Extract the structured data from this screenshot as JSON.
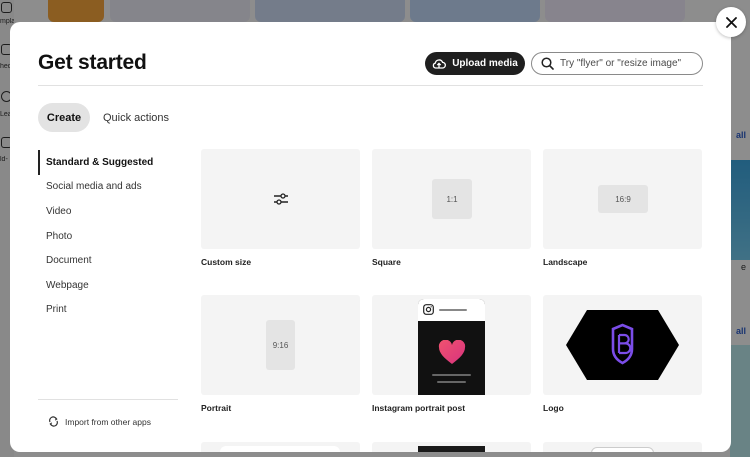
{
  "background": {
    "sidebar_labels": [
      "mpla",
      "hed",
      "Lea",
      "ld-"
    ],
    "right_links": [
      "all",
      "all"
    ],
    "right_text": "e"
  },
  "modal": {
    "title": "Get started",
    "upload_label": "Upload media",
    "search_placeholder": "Try \"flyer\" or \"resize image\"",
    "tabs": [
      {
        "label": "Create",
        "active": true
      },
      {
        "label": "Quick actions",
        "active": false
      }
    ],
    "categories": [
      {
        "label": "Standard & Suggested",
        "active": true
      },
      {
        "label": "Social media and ads"
      },
      {
        "label": "Video"
      },
      {
        "label": "Photo"
      },
      {
        "label": "Document"
      },
      {
        "label": "Webpage"
      },
      {
        "label": "Print"
      }
    ],
    "import_label": "Import from other apps",
    "cards": [
      {
        "label": "Custom size",
        "icon": "sliders-icon"
      },
      {
        "label": "Square",
        "ratio": "1:1"
      },
      {
        "label": "Landscape",
        "ratio": "16:9"
      },
      {
        "label": "Portrait",
        "ratio": "9:16"
      },
      {
        "label": "Instagram portrait post",
        "icon": "instagram-icon"
      },
      {
        "label": "Logo",
        "icon": "badge-b-icon"
      }
    ]
  },
  "colors": {
    "primary_button": "#1f1f1f",
    "heart": "#e8427c",
    "logo_accent": "#7b4de8"
  }
}
